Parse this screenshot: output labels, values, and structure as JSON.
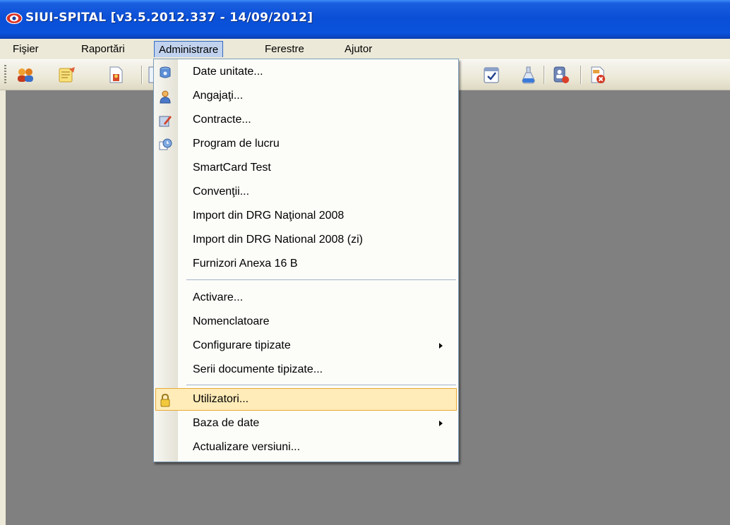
{
  "window": {
    "title": "SIUI-SPITAL [v3.5.2012.337 - 14/09/2012]",
    "icon": "eye-logo-icon"
  },
  "menubar": {
    "items": [
      {
        "label": "Fişier"
      },
      {
        "label": "Raportări"
      },
      {
        "label": "Administrare"
      },
      {
        "label": "Ferestre"
      },
      {
        "label": "Ajutor"
      }
    ]
  },
  "toolbar": {
    "icons": [
      "users-icon",
      "notes-icon",
      "document-badge-icon",
      "document-icon",
      "calendar-check-icon",
      "flask-icon",
      "card-person-icon",
      "document-delete-icon"
    ]
  },
  "dropdown": {
    "groups": [
      {
        "items": [
          {
            "label": "Date unitate...",
            "icon": "database-icon"
          },
          {
            "label": "Angajaţi...",
            "icon": "person-icon"
          },
          {
            "label": "Contracte...",
            "icon": "contract-edit-icon"
          },
          {
            "label": "Program de lucru",
            "icon": "schedule-icon"
          },
          {
            "label": "SmartCard Test",
            "icon": ""
          },
          {
            "label": "Convenţii...",
            "icon": ""
          },
          {
            "label": "Import din DRG Naţional 2008",
            "icon": ""
          },
          {
            "label": "Import din DRG National 2008 (zi)",
            "icon": ""
          },
          {
            "label": "Furnizori Anexa 16 B",
            "icon": ""
          }
        ]
      },
      {
        "items": [
          {
            "label": "Activare...",
            "icon": ""
          },
          {
            "label": "Nomenclatoare",
            "icon": ""
          },
          {
            "label": "Configurare tipizate",
            "icon": "",
            "submenu": true
          },
          {
            "label": "Serii documente tipizate...",
            "icon": ""
          }
        ]
      },
      {
        "items": [
          {
            "label": "Utilizatori...",
            "icon": "lock-icon",
            "highlighted": true
          },
          {
            "label": "Baza de date",
            "icon": "",
            "submenu": true
          },
          {
            "label": "Actualizare versiuni...",
            "icon": ""
          }
        ]
      }
    ]
  },
  "colors": {
    "titlebar": "#0a4fd6",
    "menubar": "#ece9d8",
    "workspace": "#808080",
    "highlight": "#ffecb8",
    "highlight_border": "#e6a937"
  }
}
